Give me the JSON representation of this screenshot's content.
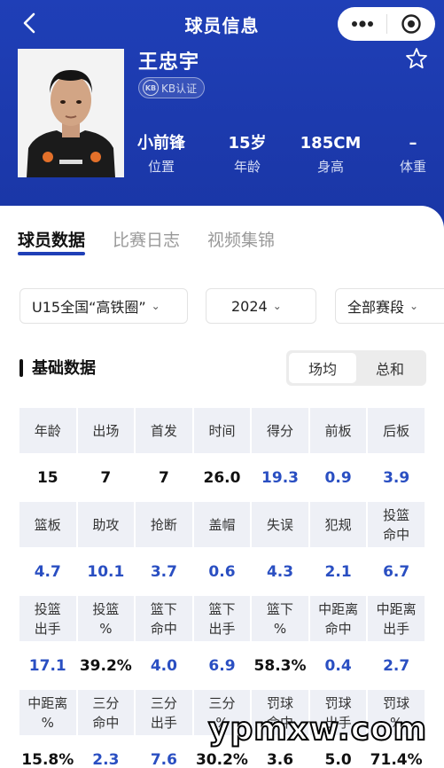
{
  "header": {
    "title": "球员信息"
  },
  "player": {
    "name": "王忠宇",
    "badge": "KB认证",
    "badge_logo": "KB",
    "info": [
      {
        "value": "小前锋",
        "label": "位置"
      },
      {
        "value": "15岁",
        "label": "年龄"
      },
      {
        "value": "185CM",
        "label": "身高"
      },
      {
        "value": "–",
        "label": "体重"
      }
    ],
    "jersey_text": "SPALDING"
  },
  "tabs": [
    {
      "label": "球员数据",
      "active": true
    },
    {
      "label": "比赛日志",
      "active": false
    },
    {
      "label": "视频集锦",
      "active": false
    }
  ],
  "filters": {
    "league": "U15全国“高铁圈”",
    "year": "2024",
    "stage": "全部赛段"
  },
  "section": {
    "title": "基础数据",
    "toggle": [
      "场均",
      "总和"
    ],
    "toggle_active": 0
  },
  "stats": [
    {
      "labels": [
        "年龄",
        "出场",
        "首发",
        "时间",
        "得分",
        "前板",
        "后板"
      ],
      "values": [
        "15",
        "7",
        "7",
        "26.0",
        "19.3",
        "0.9",
        "3.9"
      ],
      "blue": [
        false,
        false,
        false,
        false,
        true,
        true,
        true
      ]
    },
    {
      "labels": [
        "篮板",
        "助攻",
        "抢断",
        "盖帽",
        "失误",
        "犯规",
        "投篮\n命中"
      ],
      "values": [
        "4.7",
        "10.1",
        "3.7",
        "0.6",
        "4.3",
        "2.1",
        "6.7"
      ],
      "blue": [
        true,
        true,
        true,
        true,
        true,
        true,
        true
      ]
    },
    {
      "labels": [
        "投篮\n出手",
        "投篮\n%",
        "篮下\n命中",
        "篮下\n出手",
        "篮下\n%",
        "中距离\n命中",
        "中距离\n出手"
      ],
      "values": [
        "17.1",
        "39.2%",
        "4.0",
        "6.9",
        "58.3%",
        "0.4",
        "2.7"
      ],
      "blue": [
        true,
        false,
        true,
        true,
        false,
        true,
        true
      ]
    },
    {
      "labels": [
        "中距离\n%",
        "三分\n命中",
        "三分\n出手",
        "三分\n%",
        "罚球\n命中",
        "罚球\n出手",
        "罚球\n%"
      ],
      "values": [
        "15.8%",
        "2.3",
        "7.6",
        "30.2%",
        "3.6",
        "5.0",
        "71.4%"
      ],
      "blue": [
        false,
        true,
        true,
        false,
        false,
        false,
        false
      ]
    }
  ],
  "watermark": "ypmxw.com",
  "colors": {
    "brand_blue": "#1f3fb7",
    "stat_blue": "#2a4fc2",
    "label_bg": "#eef0f6"
  }
}
